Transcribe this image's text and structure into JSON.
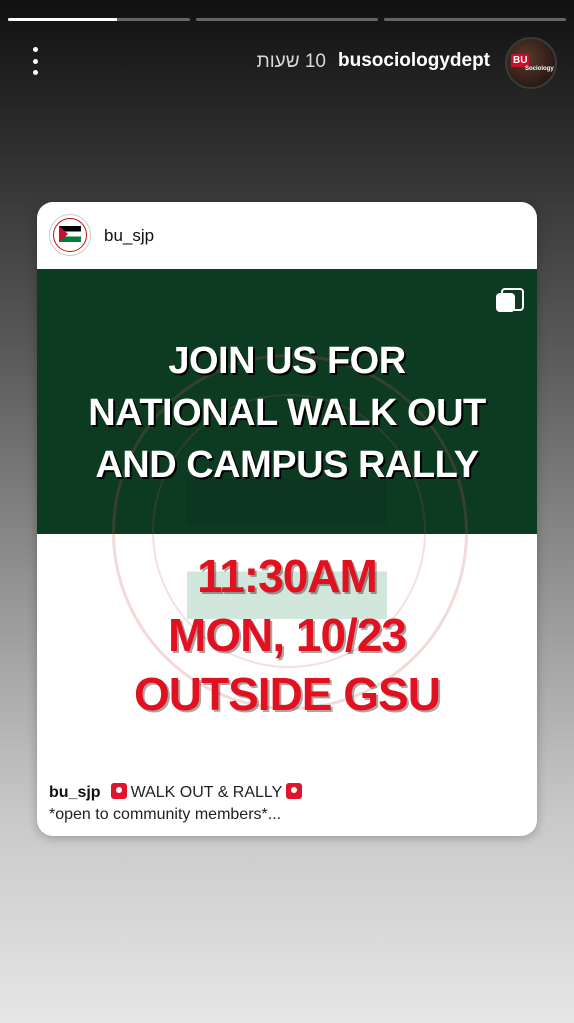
{
  "story": {
    "progress": [
      0.6,
      0,
      0
    ],
    "time": "10 שעות",
    "username": "busociologydept",
    "avatar_badge": "BU",
    "avatar_sub": "Sociology"
  },
  "card": {
    "username": "bu_sjp",
    "headline": [
      "JOIN US FOR",
      "NATIONAL WALK OUT",
      "AND CAMPUS RALLY"
    ],
    "details": [
      "11:30AM",
      "MON, 10/23",
      "OUTSIDE GSU"
    ],
    "caption": {
      "user": "bu_sjp",
      "text1": "WALK OUT & RALLY",
      "text2": "*open to community members*..."
    }
  },
  "colors": {
    "green": "#0d3b22",
    "red": "#e3111f"
  },
  "icons": [
    "more-vertical-icon",
    "multiple-posts-icon",
    "siren-icon"
  ]
}
